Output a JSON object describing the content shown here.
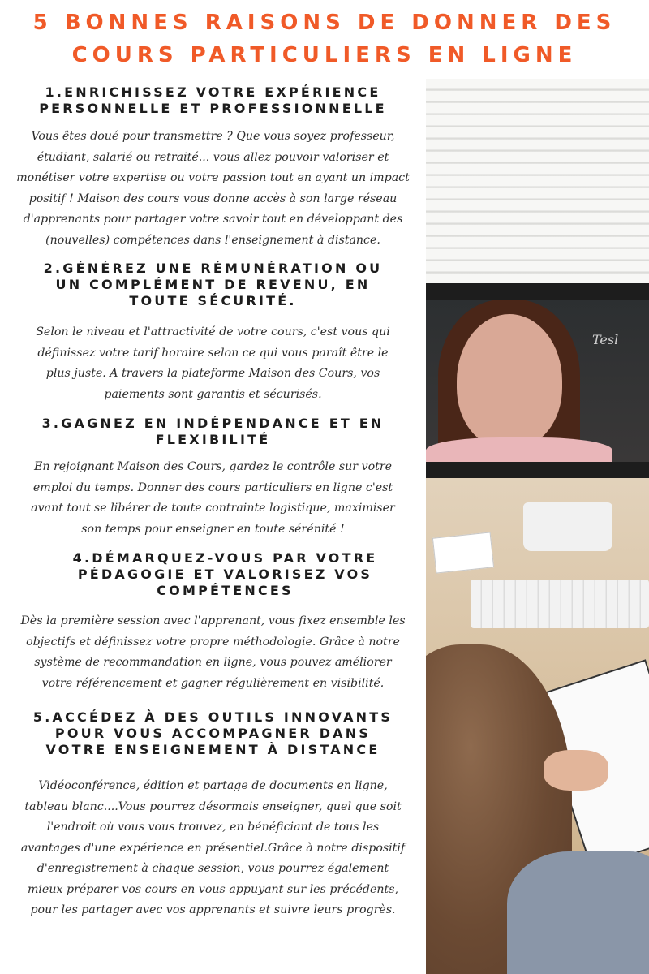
{
  "title": [
    "5 BONNES RAISONS DE DONNER DES",
    "COURS PARTICULIERS EN LIGNE"
  ],
  "screen_text": "Tesl",
  "sections": [
    {
      "heading": [
        "1.ENRICHISSEZ VOTRE EXPÉRIENCE",
        "PERSONNELLE ET PROFESSIONNELLE"
      ],
      "body": [
        "Vous êtes doué pour transmettre ? Que vous soyez professeur,",
        "étudiant, salarié ou retraité... vous allez pouvoir valoriser et",
        "monétiser votre expertise ou votre passion tout en ayant un impact",
        "positif ! Maison des cours vous donne accès à son large réseau",
        "d'apprenants pour partager votre savoir tout en développant des",
        "(nouvelles) compétences dans l'enseignement à distance."
      ]
    },
    {
      "heading": [
        "2.GÉNÉREZ UNE RÉMUNÉRATION OU",
        "UN COMPLÉMENT DE REVENU, EN",
        "TOUTE SÉCURITÉ."
      ],
      "body": [
        "Selon le niveau et l'attractivité de votre cours, c'est vous qui",
        "définissez votre tarif horaire selon ce qui vous paraît être le",
        "plus juste. A travers la plateforme Maison des Cours, vos",
        "paiements sont garantis et sécurisés."
      ]
    },
    {
      "heading": [
        "3.GAGNEZ EN INDÉPENDANCE ET EN",
        "FLEXIBILITÉ"
      ],
      "body": [
        "En rejoignant Maison des Cours, gardez le contrôle sur votre",
        "emploi du temps. Donner des cours particuliers en ligne c'est",
        "avant tout se libérer de toute contrainte logistique, maximiser",
        "son temps pour enseigner en toute sérénité !"
      ]
    },
    {
      "heading": [
        "4.DÉMARQUEZ-VOUS PAR VOTRE",
        "PÉDAGOGIE ET VALORISEZ VOS",
        "COMPÉTENCES"
      ],
      "body": [
        "Dès la première session avec l'apprenant, vous fixez ensemble les",
        "objectifs et définissez votre propre méthodologie. Grâce à notre",
        "système de recommandation en ligne, vous pouvez améliorer",
        "votre référencement et gagner régulièrement en visibilité."
      ]
    },
    {
      "heading": [
        "5.ACCÉDEZ À DES OUTILS INNOVANTS",
        "POUR VOUS ACCOMPAGNER DANS",
        "VOTRE ENSEIGNEMENT À DISTANCE"
      ],
      "body": [
        "Vidéoconférence, édition et partage de documents en ligne,",
        "tableau blanc....Vous pourrez désormais enseigner, quel que soit",
        "l'endroit où vous vous trouvez, en bénéficiant de tous les",
        "avantages d'une expérience en présentiel.Grâce à notre dispositif",
        "d'enregistrement à chaque session, vous pourrez également",
        "mieux préparer vos cours en vous appuyant sur les précédents,",
        "pour les partager avec vos apprenants et suivre leurs progrès."
      ]
    }
  ]
}
